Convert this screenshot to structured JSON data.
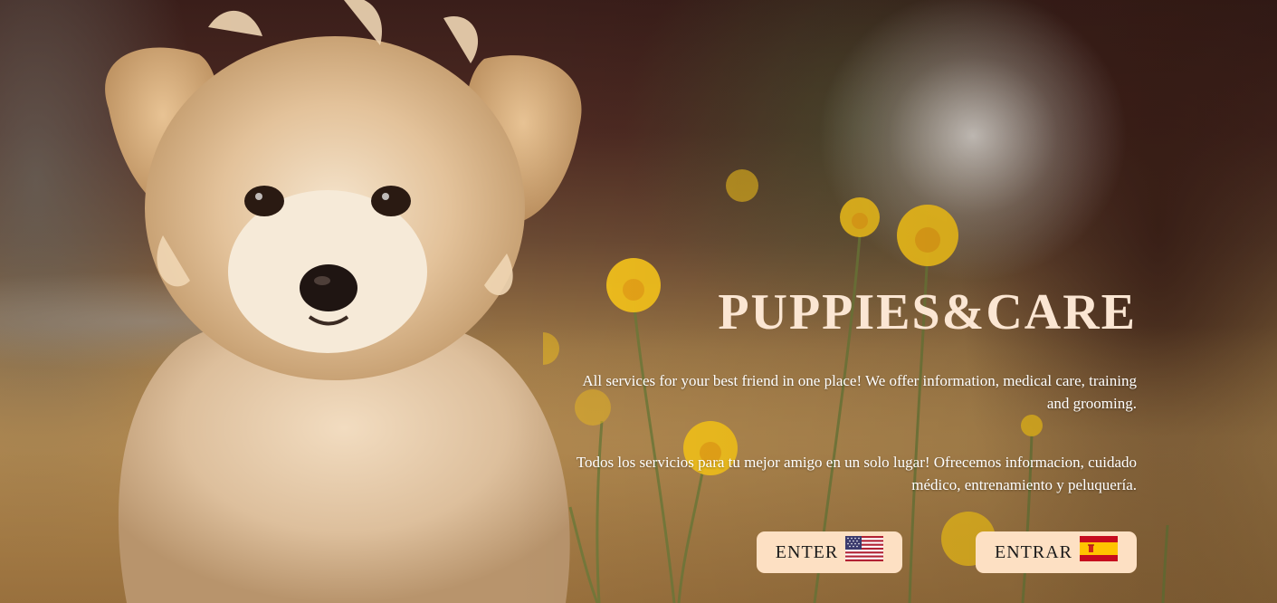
{
  "brand": {
    "title": "PUPPIES&CARE"
  },
  "descriptions": {
    "english": "All services for your best friend in one place! We offer information, medical care, training and grooming.",
    "spanish": "Todos los servicios para tu mejor amigo en un solo lugar! Ofrecemos informacion, cuidado médico, entrenamiento y peluquería."
  },
  "buttons": {
    "enter": {
      "label": "ENTER",
      "flag_icon": "us-flag-icon"
    },
    "entrar": {
      "label": "ENTRAR",
      "flag_icon": "spain-flag-icon"
    }
  },
  "colors": {
    "title": "#fbe6d3",
    "button_bg": "#fde0c3",
    "button_text": "#1a1a1a"
  },
  "background": {
    "image_subject": "fluffy-puppy-with-dandelions"
  }
}
